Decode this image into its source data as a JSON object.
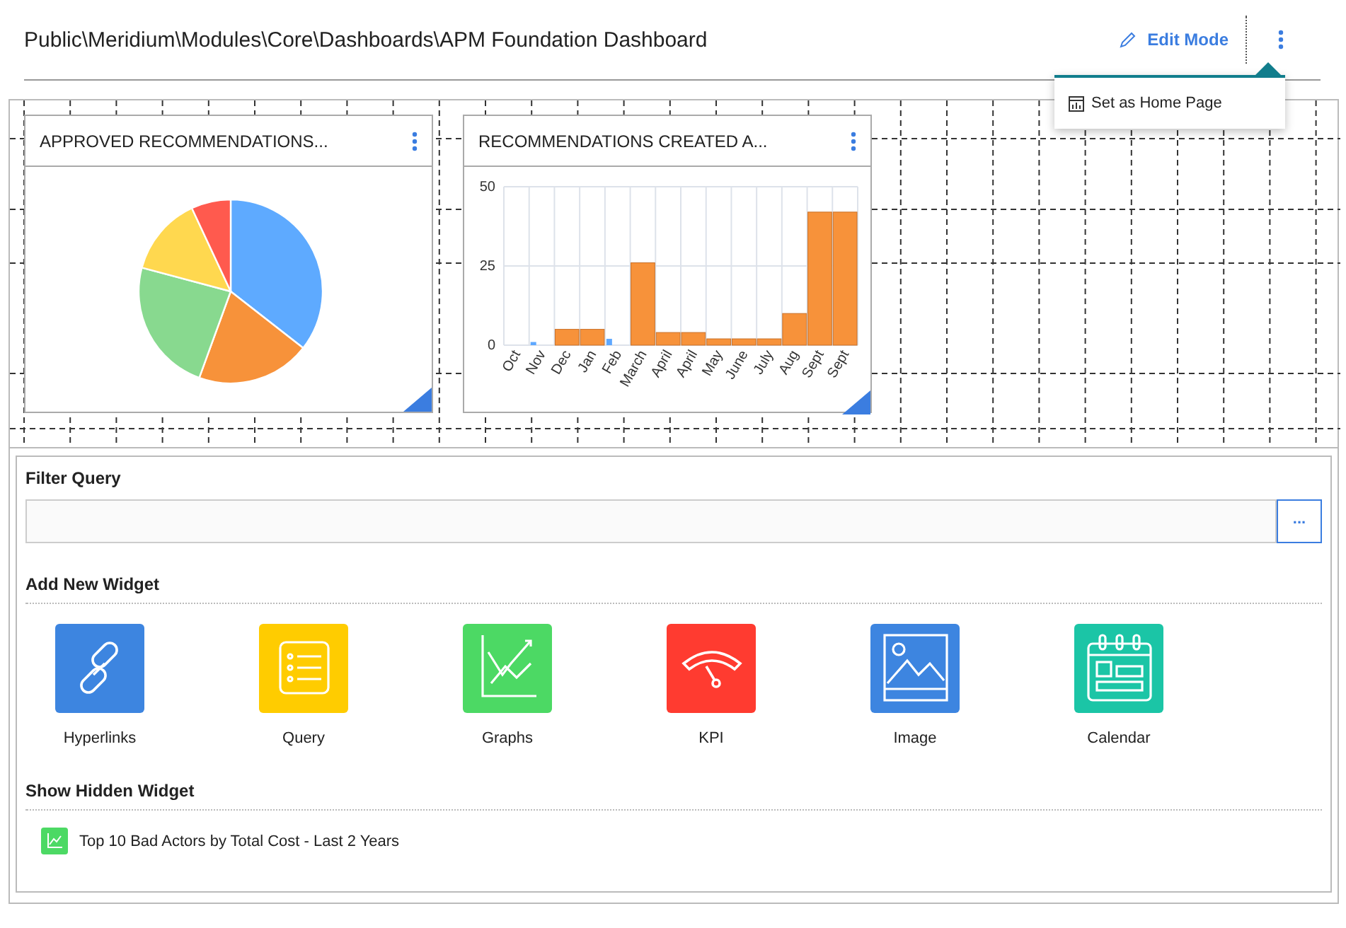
{
  "header": {
    "breadcrumb": "Public\\Meridium\\Modules\\Core\\Dashboards\\APM Foundation Dashboard",
    "edit_mode": "Edit Mode"
  },
  "menu": {
    "items": [
      "Set as Home Page"
    ]
  },
  "widgets": [
    {
      "kind": "pie",
      "title": "APPROVED RECOMMENDATIONS..."
    },
    {
      "kind": "bar",
      "title": "RECOMMENDATIONS CREATED A...",
      "chart_data": {
        "type": "bar",
        "categories": [
          "Oct",
          "Nov",
          "Dec",
          "Jan",
          "Feb",
          "March",
          "April",
          "April",
          "May",
          "June",
          "July",
          "Aug",
          "Sept",
          "Sept"
        ],
        "ylim": [
          0,
          50
        ],
        "yticks": [
          0,
          25,
          50
        ],
        "series": [
          {
            "color": "#5ea8ff",
            "values": [
              0,
              1,
              0,
              0,
              2,
              0,
              0,
              0,
              0,
              0,
              0,
              0,
              0,
              0
            ]
          },
          {
            "color": "#f7923a",
            "values": [
              0,
              0,
              5,
              5,
              0,
              26,
              4,
              4,
              2,
              2,
              2,
              10,
              42,
              42
            ]
          }
        ]
      }
    }
  ],
  "filter_query": {
    "label": "Filter Query",
    "button": "..."
  },
  "add_widget": {
    "label": "Add New Widget",
    "options": [
      {
        "kind": "link",
        "label": "Hyperlinks",
        "color": "#3d85e0"
      },
      {
        "kind": "query",
        "label": "Query",
        "color": "#ffcc00"
      },
      {
        "kind": "graph",
        "label": "Graphs",
        "color": "#4cd964"
      },
      {
        "kind": "kpi",
        "label": "KPI",
        "color": "#ff3b30"
      },
      {
        "kind": "image",
        "label": "Image",
        "color": "#3d85e0"
      },
      {
        "kind": "calendar",
        "label": "Calendar",
        "color": "#1bc5a6"
      }
    ]
  },
  "hidden_widgets": {
    "label": "Show Hidden Widget",
    "items": [
      "Top 10 Bad Actors by Total Cost - Last 2 Years"
    ]
  }
}
